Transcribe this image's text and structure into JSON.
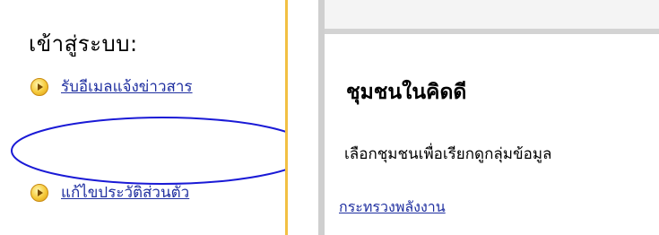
{
  "login": {
    "title": "เข้าสู่ระบบ:"
  },
  "nav": {
    "items": [
      {
        "label": "รับอีเมลแจ้งข่าวสาร",
        "icon": "arrow-circle-icon"
      },
      {
        "label": "แก้ไขประวัติส่วนตัว",
        "icon": "arrow-circle-icon"
      }
    ]
  },
  "community": {
    "title": "ชุมชนในคิดดี",
    "description": "เลือกชุมชนเพื่อเรียกดูกลุ่มข้อมูล",
    "link": "กระทรวงพลังงาน"
  },
  "colors": {
    "link": "#1f2fa0",
    "divider_gold": "#f2c043",
    "divider_gray": "#cfcfcf",
    "annotation_ellipse": "#1a1ad6"
  }
}
